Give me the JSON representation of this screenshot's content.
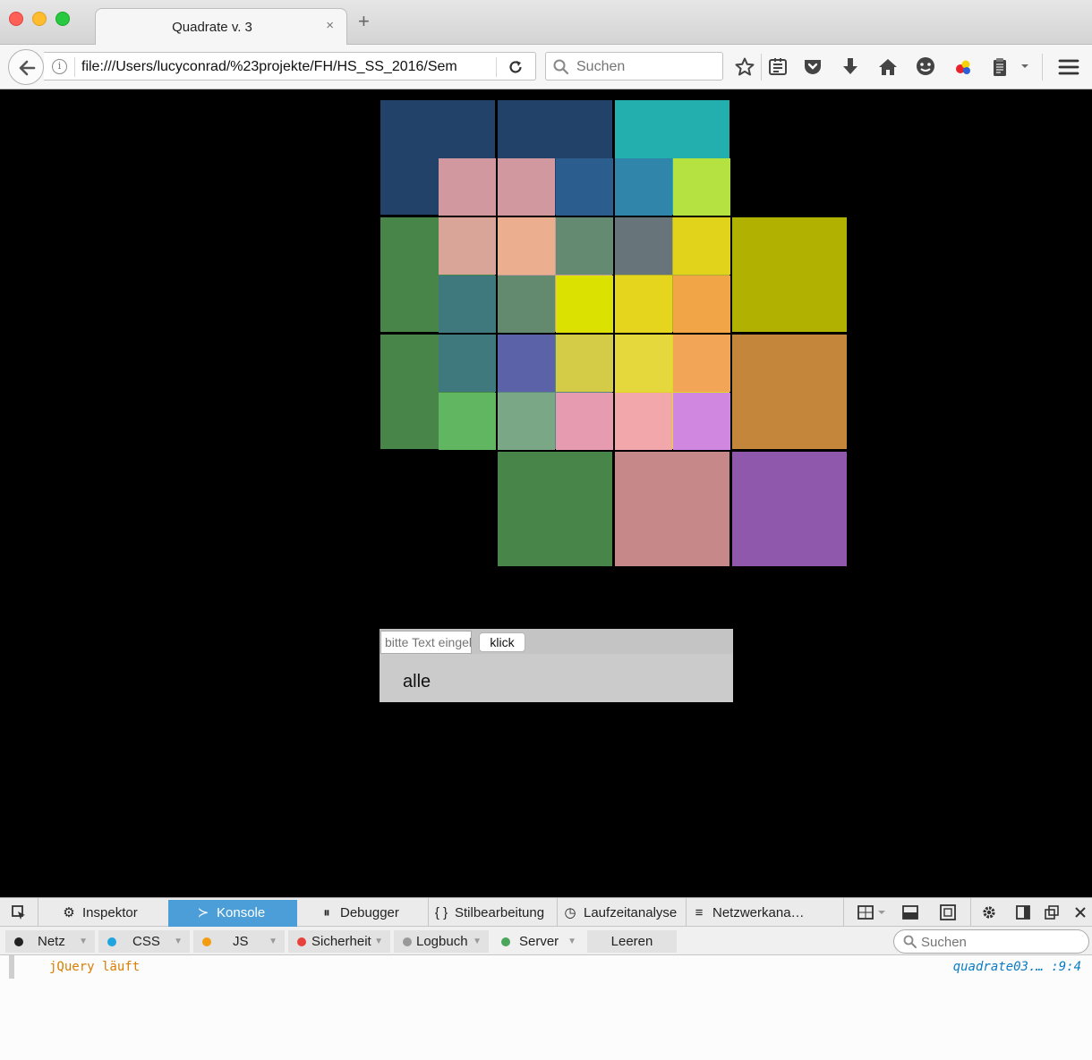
{
  "browser": {
    "tab_title": "Quadrate v. 3",
    "tab_close": "×",
    "new_tab": "+",
    "url": "file:///Users/lucyconrad/%23projekte/FH/HS_SS_2016/Sem",
    "search_placeholder": "Suchen"
  },
  "toolbar_icons": [
    "star-icon",
    "reading-list-icon",
    "pocket-icon",
    "download-icon",
    "home-icon",
    "chat-icon",
    "colorful-extension-icon",
    "clipboard-icon",
    "menu-icon"
  ],
  "grid": {
    "big_squares": [
      [
        "#23426a",
        "#23426a",
        "#22afae",
        "#000000"
      ],
      [
        "#478549",
        "#c49d9b",
        "#b1ae2e",
        "#b0b100"
      ],
      [
        "#478549",
        "#588780",
        "#e0d91f",
        "#c3863b"
      ],
      [
        "#000000",
        "#478549",
        "#c68888",
        "#8f58ac"
      ]
    ],
    "small_squares": [
      [
        "#d2989f",
        "#d2989f",
        "#2b5e8f",
        "#2f86aa",
        "#b5e240"
      ],
      [
        "#d8a598",
        "#ebaf8f",
        "#648a72",
        "#677479",
        "#e1d21b"
      ],
      [
        "#3f787d",
        "#638a6f",
        "#dbe201",
        "#e5d51d",
        "#f2a547"
      ],
      [
        "#3f787d",
        "#5b62a8",
        "#d4cc47",
        "#e4d83c",
        "#f2a556"
      ],
      [
        "#61b662",
        "#7aa786",
        "#e79bb0",
        "#f2a7aa",
        "#d087e0"
      ]
    ]
  },
  "form": {
    "input_placeholder": "bitte Text eingeben",
    "button_label": "klick",
    "output": "alle"
  },
  "devtools": {
    "tabs": [
      {
        "label": "Inspektor",
        "icon": "inspector-icon",
        "active": false
      },
      {
        "label": "Konsole",
        "icon": "console-icon",
        "active": true
      },
      {
        "label": "Debugger",
        "icon": "debugger-icon",
        "active": false
      },
      {
        "label": "Stilbearbeitung",
        "icon": "style-editor-icon",
        "active": false
      },
      {
        "label": "Laufzeitanalyse",
        "icon": "performance-icon",
        "active": false
      },
      {
        "label": "Netzwerkana…",
        "icon": "network-icon",
        "active": false
      }
    ],
    "filters": [
      {
        "label": "Netz",
        "color": "#222222"
      },
      {
        "label": "CSS",
        "color": "#1fa4e0"
      },
      {
        "label": "JS",
        "color": "#f39c12"
      },
      {
        "label": "Sicherheit",
        "color": "#e8413b"
      },
      {
        "label": "Logbuch",
        "color": "#999999"
      },
      {
        "label": "Server",
        "color": "#4aa65a"
      }
    ],
    "clear_label": "Leeren",
    "search_placeholder": "Suchen",
    "console": {
      "message": "jQuery läuft",
      "source": "quadrate03.… :9:4"
    }
  }
}
